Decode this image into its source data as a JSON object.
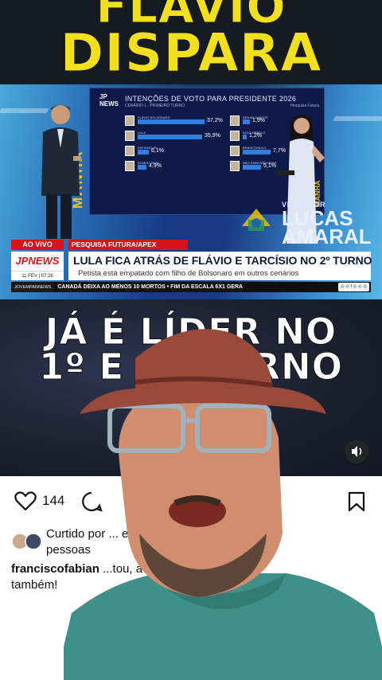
{
  "headline": {
    "line1": "FLÁVIO",
    "line2": "DISPARA"
  },
  "tv": {
    "panel_logo": "JP NEWS",
    "panel_title": "INTENÇÕES DE VOTO PARA PRESIDENTE 2026",
    "panel_subtitle": "CENÁRIO 1 · PRIMEIRO TURNO",
    "panel_source": "Pesquisa Futura",
    "side_text": "MANHÃ",
    "left_candidates": [
      {
        "name": "FLÁVIO BOLSONARO",
        "percent": "37,2%",
        "value": 37.2
      },
      {
        "name": "LULA",
        "percent": "35,9%",
        "value": 35.9
      },
      {
        "name": "RATINHO JR",
        "percent": "6,1%",
        "value": 6.1
      },
      {
        "name": "ROMEU ZEMA",
        "percent": "4,9%",
        "value": 4.9
      }
    ],
    "right_candidates": [
      {
        "name": "RENAN SANTOS",
        "percent": "1,9%",
        "value": 1.9
      },
      {
        "name": "ALDO REBELO",
        "percent": "1,2%",
        "value": 1.2
      },
      {
        "name": "BRANCO/NULO",
        "percent": "7,7%",
        "value": 7.7
      },
      {
        "name": "NÃO SABE/NÃO RESP.",
        "percent": "5,1%",
        "value": 5.1
      }
    ],
    "watermark": {
      "small": "VEREADOR",
      "line1": "LUCAS",
      "line2": "AMARAL"
    }
  },
  "lower_third": {
    "live": "AO VIVO",
    "tag": "PESQUISA FUTURA/APEX",
    "logo": "JPNEWS",
    "date": "11 FEV | 07:26",
    "headline": "LULA FICA ATRÁS DE FLÁVIO E TARCÍSIO NO 2º TURNO",
    "subheadline": "Petista está empatado com filho de Bolsonaro em outros cenários",
    "ticker_brand": "JOVEMPANNEWS",
    "ticker": "CANADÁ DEIXA AO MENOS 10 MORTOS • FIM DA ESCALA 6X1 GERA",
    "ticker_social": "◎ ◎ f ◎ ◎ ◎"
  },
  "video": {
    "line1": "JÁ É LÍDER NO",
    "line2": "1º E 2º TURNO"
  },
  "instagram": {
    "like_count": "144",
    "liked_by_line1": "Curtido por ... e outras",
    "liked_by_line2": "pessoas",
    "caption_user": "franciscofabian",
    "caption_text": "...tou, a corrupção",
    "caption_line2": "também!"
  },
  "colors": {
    "headline_yellow": "#f2df1f",
    "news_red": "#d7141d",
    "panel_blue": "#0d1a4a"
  },
  "icons": [
    "heart-icon",
    "comment-icon",
    "bookmark-icon",
    "speaker-icon"
  ]
}
